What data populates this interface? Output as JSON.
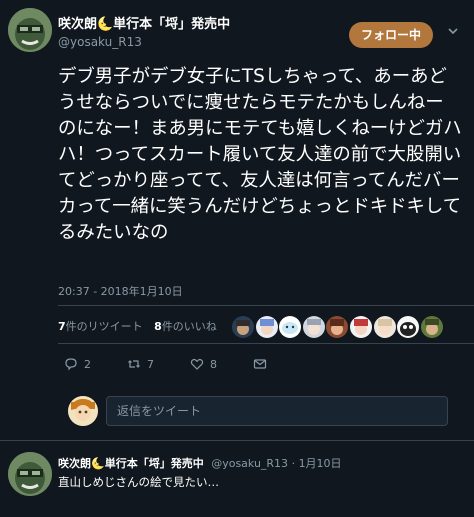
{
  "tweet": {
    "author_name": "咲次朗🌜単行本「埒」発売中",
    "author_handle": "@yosaku_R13",
    "follow_label": "フォロー中",
    "text": "デブ男子がデブ女子にTSしちゃって、あーあどうせならついでに痩せたらモテたかもしんねーのになー！まあ男にモテても嬉しくねーけどガハハ！つってスカート履いて友人達の前で大股開いてどっかり座ってて、友人達は何言ってんだバーカって一緒に笑うんだけどちょっとドキドキしてるみたいなの",
    "timestamp": "20:37 - 2018年1月10日"
  },
  "stats": {
    "retweet_count": "7",
    "retweet_label": "件のリツイート",
    "like_count": "8",
    "like_label": "件のいいね"
  },
  "actions": {
    "reply_count": "2",
    "retweet_count": "7",
    "like_count": "8"
  },
  "reply": {
    "placeholder": "返信をツイート"
  },
  "second_tweet": {
    "author_name": "咲次朗🌜単行本「埒」発売中",
    "author_handle": "@yosaku_R13",
    "separator": " · ",
    "time": "1月10日",
    "text": "直山しめじさんの絵で見たい…"
  },
  "icons": [
    "chevron-down-icon",
    "reply-icon",
    "retweet-icon",
    "heart-icon",
    "dm-icon"
  ],
  "colors": {
    "background": "#10171e",
    "follow_button": "#b2773c",
    "secondary_text": "#8899a6",
    "divider": "#38444d"
  }
}
